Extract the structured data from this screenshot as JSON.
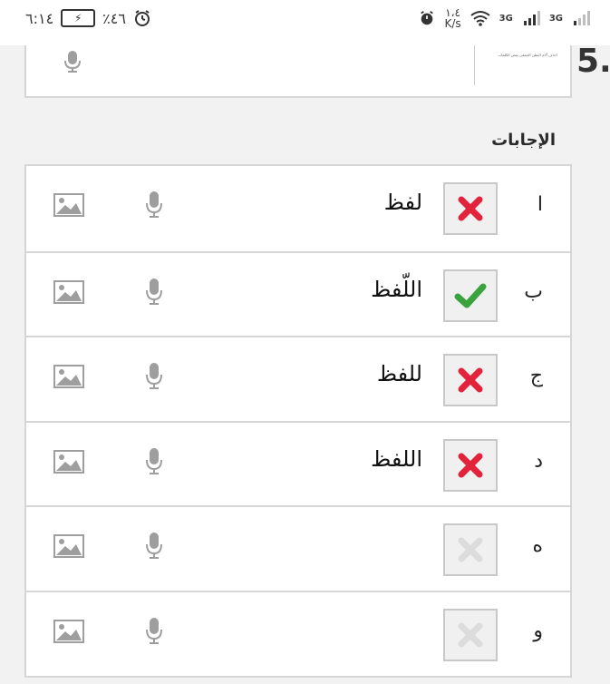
{
  "status_bar": {
    "time": "٦:١٤",
    "battery_percent": "٪٤٦",
    "speed_value": "١،٤",
    "speed_unit": "K/s",
    "network1": "3G",
    "network2": "3G"
  },
  "question": {
    "number": "5.",
    "thumbnail_text": "احذف آلام البطن الحمقى بعض الكلمات"
  },
  "answers_label": "الإجابات",
  "answers": [
    {
      "letter": "ا",
      "text": "لفظ",
      "status": "wrong"
    },
    {
      "letter": "ب",
      "text": "اللّفظ",
      "status": "correct"
    },
    {
      "letter": "ج",
      "text": "للفظ",
      "status": "wrong"
    },
    {
      "letter": "د",
      "text": "اللفظ",
      "status": "wrong"
    },
    {
      "letter": "ه",
      "text": "",
      "status": "empty"
    },
    {
      "letter": "و",
      "text": "",
      "status": "empty"
    }
  ],
  "colors": {
    "wrong": "#e1233b",
    "correct": "#3aa33d",
    "empty": "#dcdcdc",
    "icon_gray": "#9e9e9e",
    "border": "#d6d6d6"
  }
}
